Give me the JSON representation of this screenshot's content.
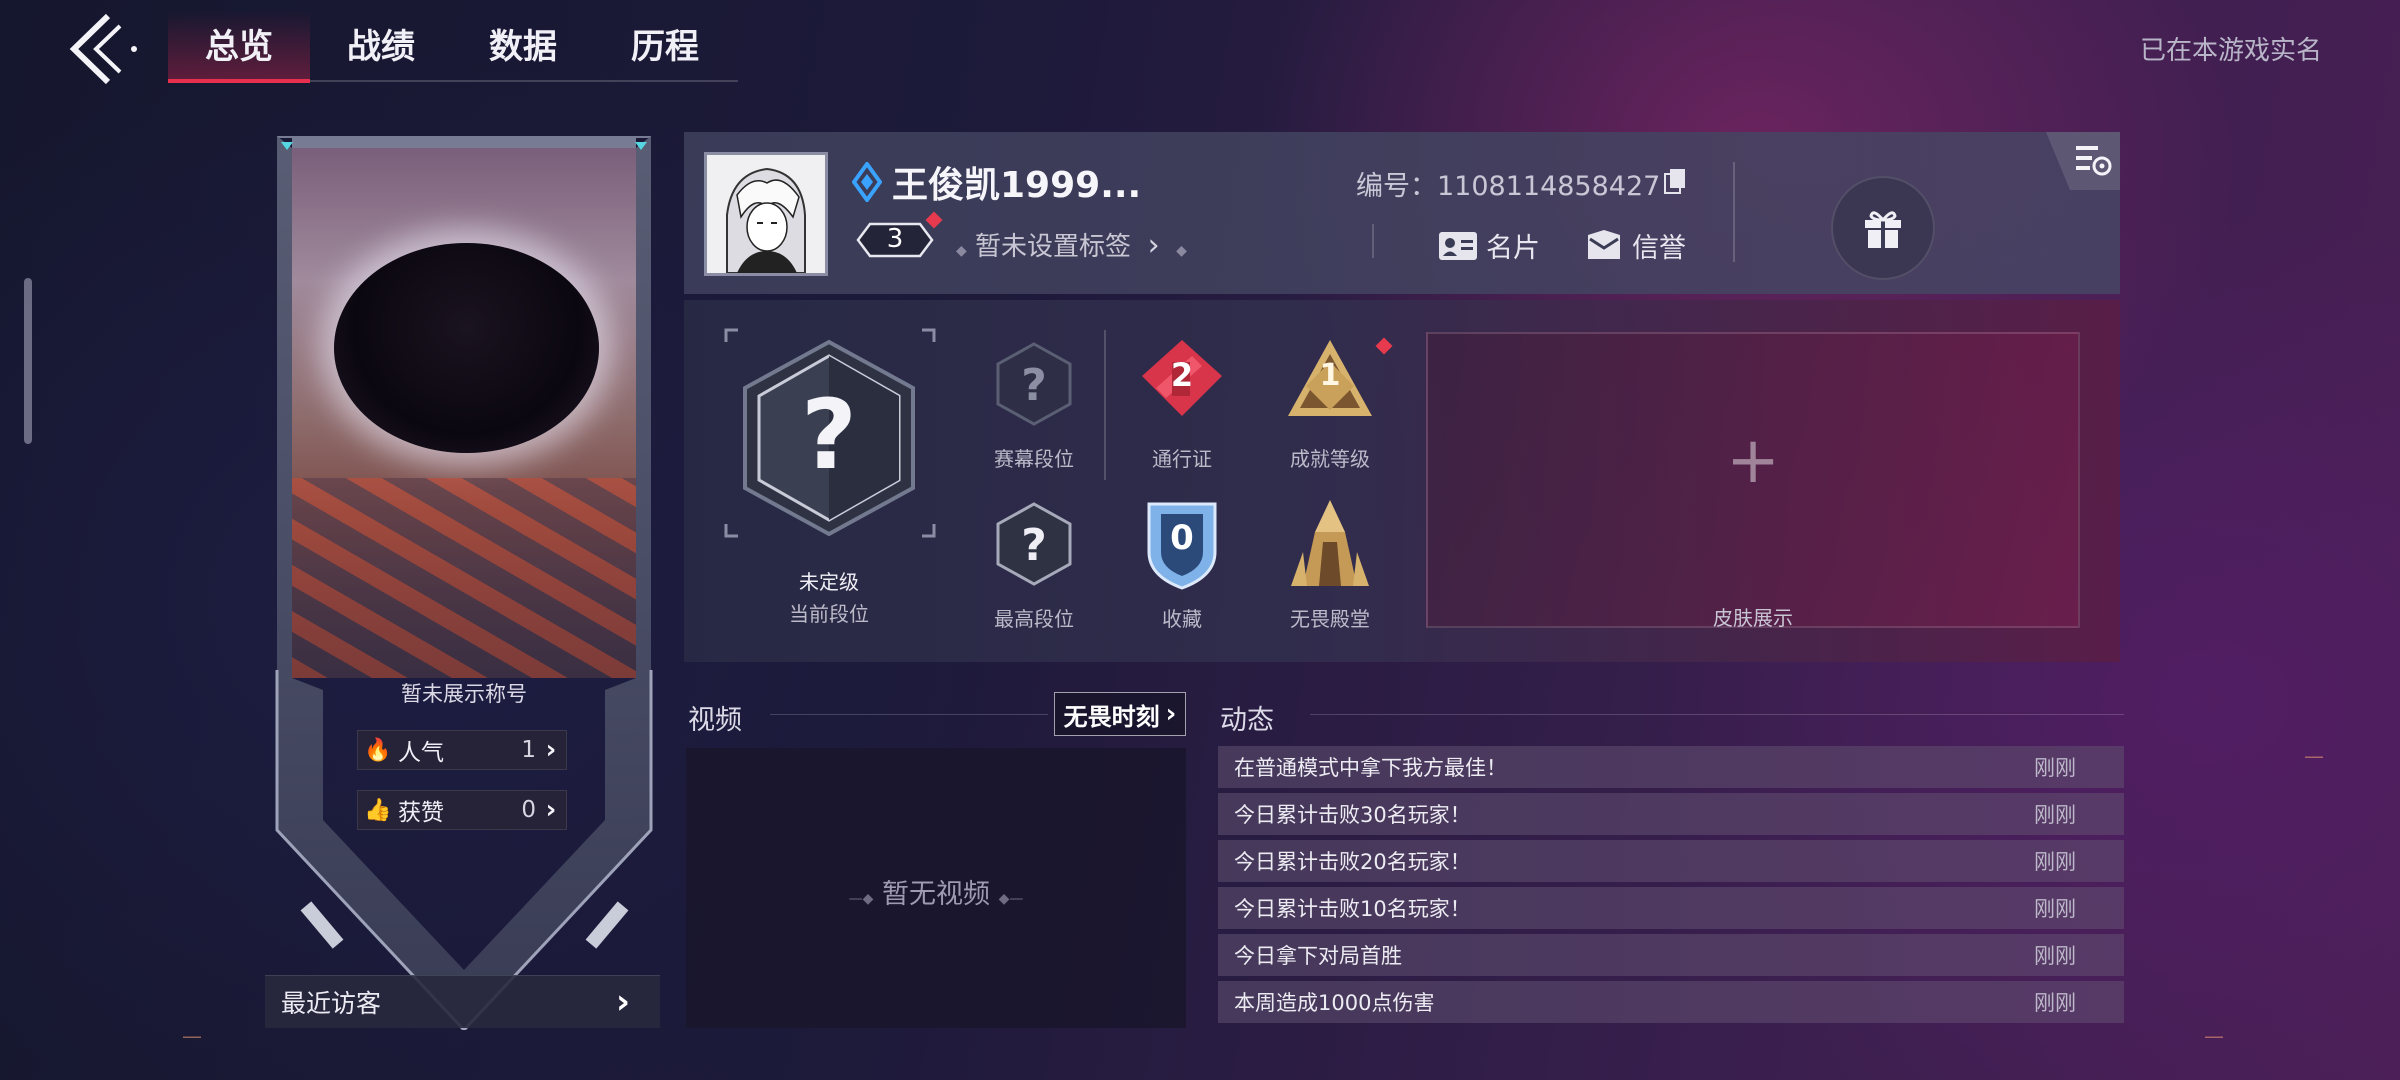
{
  "nav": {
    "tabs": [
      {
        "label": "总览",
        "active": true
      },
      {
        "label": "战绩",
        "active": false
      },
      {
        "label": "数据",
        "active": false
      },
      {
        "label": "历程",
        "active": false
      }
    ],
    "realname_status": "已在本游戏实名"
  },
  "left_card": {
    "title_text": "暂未展示称号",
    "popularity_label": "人气",
    "popularity_value": "1",
    "likes_label": "获赞",
    "likes_value": "0",
    "recent_visitors": "最近访客"
  },
  "profile": {
    "name": "王俊凯1999...",
    "level": "3",
    "tag_text": "暂未设置标签",
    "id_label": "编号：",
    "id_value": "1108114858427",
    "card_label": "名片",
    "credit_label": "信誉"
  },
  "ranks": {
    "current_rank_value": "未定级",
    "current_rank_label": "当前段位",
    "season_rank_label": "赛幕段位",
    "highest_rank_label": "最高段位",
    "pass_value": "2",
    "pass_label": "通行证",
    "achievement_value": "1",
    "achievement_label": "成就等级",
    "collection_value": "0",
    "collection_label": "收藏",
    "hall_label": "无畏殿堂",
    "skin_label": "皮肤展示"
  },
  "video": {
    "title": "视频",
    "moment_button": "无畏时刻",
    "empty_text": "暂无视频"
  },
  "feed": {
    "title": "动态",
    "items": [
      {
        "text": "在普通模式中拿下我方最佳！",
        "time": "刚刚"
      },
      {
        "text": "今日累计击败30名玩家！",
        "time": "刚刚"
      },
      {
        "text": "今日累计击败20名玩家！",
        "time": "刚刚"
      },
      {
        "text": "今日累计击败10名玩家！",
        "time": "刚刚"
      },
      {
        "text": "今日拿下对局首胜",
        "time": "刚刚"
      },
      {
        "text": "本周造成1000点伤害",
        "time": "刚刚"
      }
    ]
  },
  "colors": {
    "accent_red": "#e8304e",
    "pass_red": "#e04050",
    "achievement_gold": "#c9a15a",
    "collection_blue": "#7fb2e8"
  }
}
